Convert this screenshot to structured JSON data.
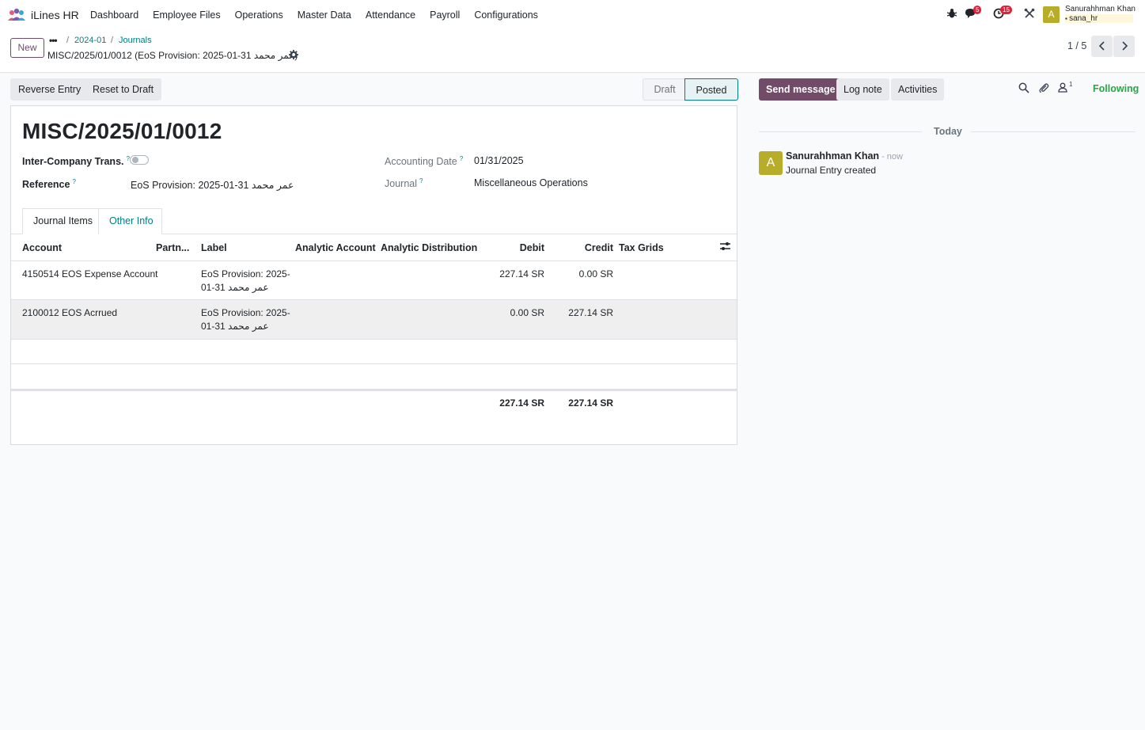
{
  "app": {
    "name": "iLines HR"
  },
  "menu": [
    "Dashboard",
    "Employee Files",
    "Operations",
    "Master Data",
    "Attendance",
    "Payroll",
    "Configurations"
  ],
  "systray": {
    "messages_count": "5",
    "activities_count": "15",
    "user_name": "Sanurahhman Khan",
    "user_initial": "A",
    "database": "sana_hr"
  },
  "control": {
    "new_label": "New",
    "breadcrumb": [
      "2024-01",
      "Journals"
    ],
    "record_title": "MISC/2025/01/0012 (EoS Provision: 2025-01-31 عمر محمد)",
    "pager": "1 / 5"
  },
  "actions": {
    "reverse": "Reverse Entry",
    "reset": "Reset to Draft"
  },
  "statusbar": {
    "draft": "Draft",
    "posted": "Posted"
  },
  "form": {
    "name": "MISC/2025/01/0012",
    "inter_company_label": "Inter-Company Trans.",
    "reference_label": "Reference",
    "reference_value": "EoS Provision: 2025-01-31 عمر محمد",
    "accounting_date_label": "Accounting Date",
    "accounting_date_value": "01/31/2025",
    "journal_label": "Journal",
    "journal_value": "Miscellaneous Operations",
    "help": "?"
  },
  "tabs": [
    "Journal Items",
    "Other Info"
  ],
  "table": {
    "columns": [
      "Account",
      "Partn...",
      "Label",
      "Analytic Account",
      "Analytic Distribution",
      "Debit",
      "Credit",
      "Tax Grids"
    ],
    "rows": [
      {
        "account": "4150514 EOS Expense Account",
        "label1": "EoS Provision: 2025-",
        "label2": "01-31 عمر محمد",
        "debit": "227.14 SR",
        "credit": "0.00 SR"
      },
      {
        "account": "2100012 EOS Acrrued",
        "label1": "EoS Provision: 2025-",
        "label2": "01-31 عمر محمد",
        "debit": "0.00 SR",
        "credit": "227.14 SR"
      }
    ],
    "total_debit": "227.14 SR",
    "total_credit": "227.14 SR"
  },
  "chatter": {
    "send": "Send message",
    "log": "Log note",
    "activities": "Activities",
    "followers_count": "1",
    "following": "Following",
    "today": "Today",
    "author": "Sanurahhman Khan",
    "time": "- now",
    "avatar_initial": "A",
    "body": "Journal Entry created"
  },
  "colors": {
    "brand": "#714b67",
    "link": "#017e84",
    "avatar": "#b7ad2a",
    "following": "#28a745"
  }
}
